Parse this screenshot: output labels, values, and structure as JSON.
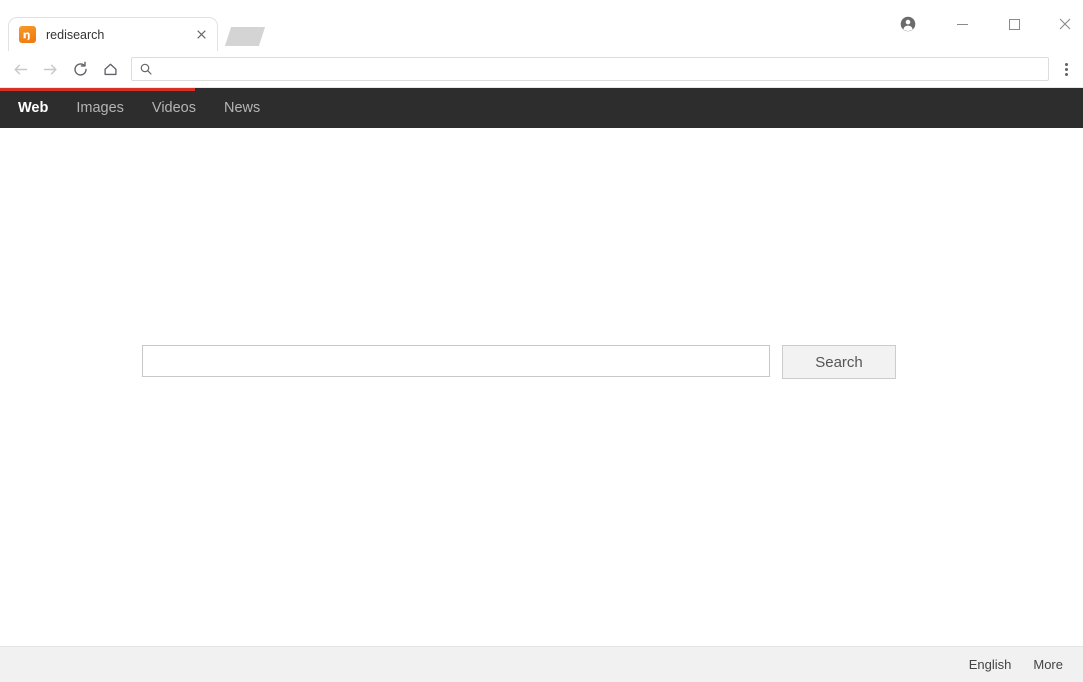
{
  "window": {
    "clipped_title_text": "",
    "controls": {
      "profile_icon": "account-circle-icon",
      "minimize_label": "",
      "maximize_label": "",
      "close_label": ""
    }
  },
  "tabstrip": {
    "tabs": [
      {
        "title": "redisearch",
        "favicon": "redisearch-favicon",
        "favicon_color": "#ee7711",
        "close_label": "×"
      }
    ],
    "new_tab_ghost": true
  },
  "toolbar": {
    "back_icon": "back-arrow-icon",
    "forward_icon": "forward-arrow-icon",
    "reload_icon": "reload-icon",
    "home_icon": "home-icon",
    "menu_icon": "three-dot-menu-icon",
    "omnibox": {
      "icon": "search-icon",
      "value": "",
      "placeholder": ""
    }
  },
  "page": {
    "progress": {
      "percent": 18,
      "color": "#d93025"
    },
    "sitenav": {
      "background": "#2d2d2d",
      "items": [
        {
          "label": "Web",
          "active": true
        },
        {
          "label": "Images",
          "active": false
        },
        {
          "label": "Videos",
          "active": false
        },
        {
          "label": "News",
          "active": false
        }
      ]
    },
    "search": {
      "input_value": "",
      "input_placeholder": "",
      "button_label": "Search"
    },
    "footer": {
      "links": [
        {
          "label": "English"
        },
        {
          "label": "More"
        }
      ]
    }
  }
}
